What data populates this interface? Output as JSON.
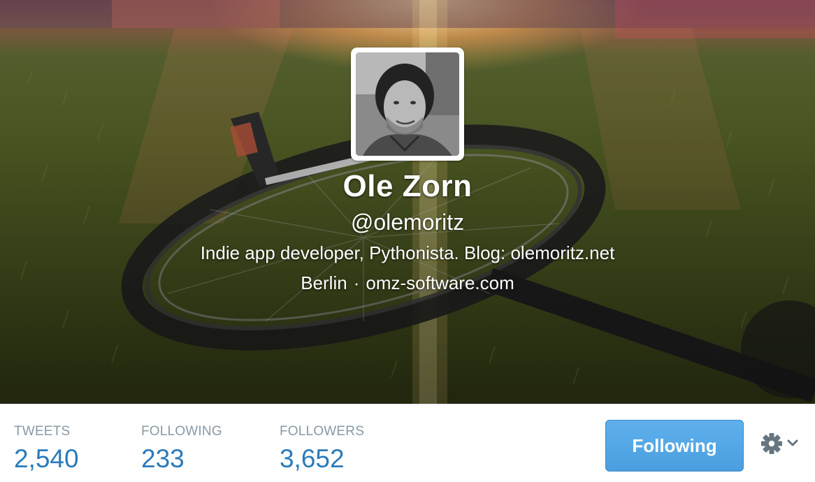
{
  "profile": {
    "name": "Ole Zorn",
    "screen_name": "@olemoritz",
    "bio": "Indie app developer, Pythonista. Blog: olemoritz.net",
    "location": "Berlin",
    "separator": "·",
    "website": "omz-software.com"
  },
  "stats": {
    "tweets": {
      "label": "TWEETS",
      "value": "2,540"
    },
    "following": {
      "label": "FOLLOWING",
      "value": "233"
    },
    "followers": {
      "label": "FOLLOWERS",
      "value": "3,652"
    }
  },
  "actions": {
    "follow_label": "Following",
    "settings_icon": "gear-icon",
    "dropdown_icon": "chevron-down-icon"
  },
  "colors": {
    "stat_value": "#2b7bb9",
    "stat_label": "#8899a6",
    "follow_button": "#55acee"
  }
}
